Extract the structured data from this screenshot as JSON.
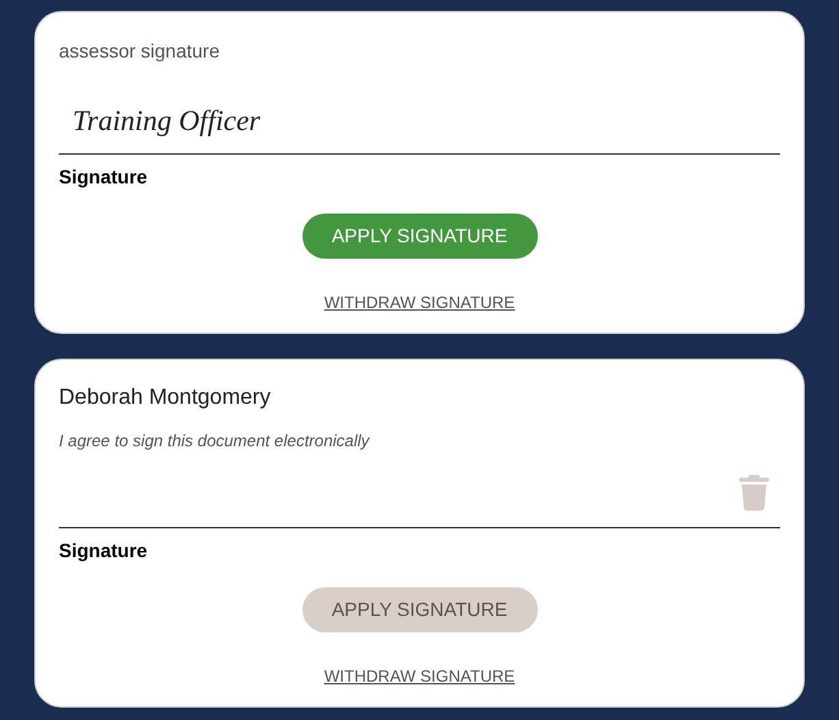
{
  "cards": [
    {
      "kind": "label",
      "heading": "assessor signature",
      "signature": "Training Officer",
      "show_clear": false,
      "signature_label": "Signature",
      "apply_button": {
        "label": "APPLY SIGNATURE",
        "disabled": false
      },
      "withdraw_link": "WITHDRAW SIGNATURE"
    },
    {
      "kind": "name",
      "heading": "Deborah Montgomery",
      "note": "I agree to sign this document electronically",
      "show_clear": true,
      "signature_label": "Signature",
      "apply_button": {
        "label": "APPLY SIGNATURE",
        "disabled": true
      },
      "withdraw_link": "WITHDRAW SIGNATURE"
    }
  ]
}
